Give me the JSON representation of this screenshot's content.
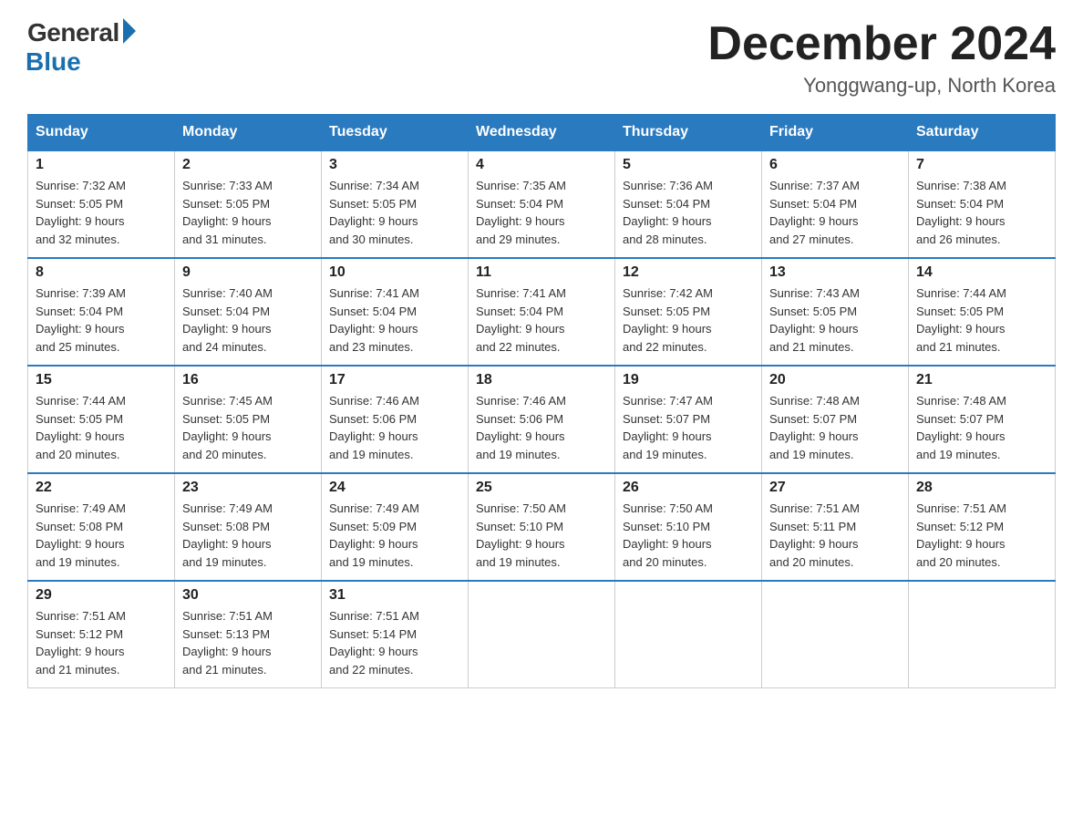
{
  "header": {
    "logo_general": "General",
    "logo_blue": "Blue",
    "month_title": "December 2024",
    "location": "Yonggwang-up, North Korea"
  },
  "weekdays": [
    "Sunday",
    "Monday",
    "Tuesday",
    "Wednesday",
    "Thursday",
    "Friday",
    "Saturday"
  ],
  "weeks": [
    [
      {
        "day": "1",
        "sunrise": "7:32 AM",
        "sunset": "5:05 PM",
        "daylight": "9 hours and 32 minutes."
      },
      {
        "day": "2",
        "sunrise": "7:33 AM",
        "sunset": "5:05 PM",
        "daylight": "9 hours and 31 minutes."
      },
      {
        "day": "3",
        "sunrise": "7:34 AM",
        "sunset": "5:05 PM",
        "daylight": "9 hours and 30 minutes."
      },
      {
        "day": "4",
        "sunrise": "7:35 AM",
        "sunset": "5:04 PM",
        "daylight": "9 hours and 29 minutes."
      },
      {
        "day": "5",
        "sunrise": "7:36 AM",
        "sunset": "5:04 PM",
        "daylight": "9 hours and 28 minutes."
      },
      {
        "day": "6",
        "sunrise": "7:37 AM",
        "sunset": "5:04 PM",
        "daylight": "9 hours and 27 minutes."
      },
      {
        "day": "7",
        "sunrise": "7:38 AM",
        "sunset": "5:04 PM",
        "daylight": "9 hours and 26 minutes."
      }
    ],
    [
      {
        "day": "8",
        "sunrise": "7:39 AM",
        "sunset": "5:04 PM",
        "daylight": "9 hours and 25 minutes."
      },
      {
        "day": "9",
        "sunrise": "7:40 AM",
        "sunset": "5:04 PM",
        "daylight": "9 hours and 24 minutes."
      },
      {
        "day": "10",
        "sunrise": "7:41 AM",
        "sunset": "5:04 PM",
        "daylight": "9 hours and 23 minutes."
      },
      {
        "day": "11",
        "sunrise": "7:41 AM",
        "sunset": "5:04 PM",
        "daylight": "9 hours and 22 minutes."
      },
      {
        "day": "12",
        "sunrise": "7:42 AM",
        "sunset": "5:05 PM",
        "daylight": "9 hours and 22 minutes."
      },
      {
        "day": "13",
        "sunrise": "7:43 AM",
        "sunset": "5:05 PM",
        "daylight": "9 hours and 21 minutes."
      },
      {
        "day": "14",
        "sunrise": "7:44 AM",
        "sunset": "5:05 PM",
        "daylight": "9 hours and 21 minutes."
      }
    ],
    [
      {
        "day": "15",
        "sunrise": "7:44 AM",
        "sunset": "5:05 PM",
        "daylight": "9 hours and 20 minutes."
      },
      {
        "day": "16",
        "sunrise": "7:45 AM",
        "sunset": "5:05 PM",
        "daylight": "9 hours and 20 minutes."
      },
      {
        "day": "17",
        "sunrise": "7:46 AM",
        "sunset": "5:06 PM",
        "daylight": "9 hours and 19 minutes."
      },
      {
        "day": "18",
        "sunrise": "7:46 AM",
        "sunset": "5:06 PM",
        "daylight": "9 hours and 19 minutes."
      },
      {
        "day": "19",
        "sunrise": "7:47 AM",
        "sunset": "5:07 PM",
        "daylight": "9 hours and 19 minutes."
      },
      {
        "day": "20",
        "sunrise": "7:48 AM",
        "sunset": "5:07 PM",
        "daylight": "9 hours and 19 minutes."
      },
      {
        "day": "21",
        "sunrise": "7:48 AM",
        "sunset": "5:07 PM",
        "daylight": "9 hours and 19 minutes."
      }
    ],
    [
      {
        "day": "22",
        "sunrise": "7:49 AM",
        "sunset": "5:08 PM",
        "daylight": "9 hours and 19 minutes."
      },
      {
        "day": "23",
        "sunrise": "7:49 AM",
        "sunset": "5:08 PM",
        "daylight": "9 hours and 19 minutes."
      },
      {
        "day": "24",
        "sunrise": "7:49 AM",
        "sunset": "5:09 PM",
        "daylight": "9 hours and 19 minutes."
      },
      {
        "day": "25",
        "sunrise": "7:50 AM",
        "sunset": "5:10 PM",
        "daylight": "9 hours and 19 minutes."
      },
      {
        "day": "26",
        "sunrise": "7:50 AM",
        "sunset": "5:10 PM",
        "daylight": "9 hours and 20 minutes."
      },
      {
        "day": "27",
        "sunrise": "7:51 AM",
        "sunset": "5:11 PM",
        "daylight": "9 hours and 20 minutes."
      },
      {
        "day": "28",
        "sunrise": "7:51 AM",
        "sunset": "5:12 PM",
        "daylight": "9 hours and 20 minutes."
      }
    ],
    [
      {
        "day": "29",
        "sunrise": "7:51 AM",
        "sunset": "5:12 PM",
        "daylight": "9 hours and 21 minutes."
      },
      {
        "day": "30",
        "sunrise": "7:51 AM",
        "sunset": "5:13 PM",
        "daylight": "9 hours and 21 minutes."
      },
      {
        "day": "31",
        "sunrise": "7:51 AM",
        "sunset": "5:14 PM",
        "daylight": "9 hours and 22 minutes."
      },
      null,
      null,
      null,
      null
    ]
  ],
  "labels": {
    "sunrise": "Sunrise:",
    "sunset": "Sunset:",
    "daylight": "Daylight:"
  }
}
